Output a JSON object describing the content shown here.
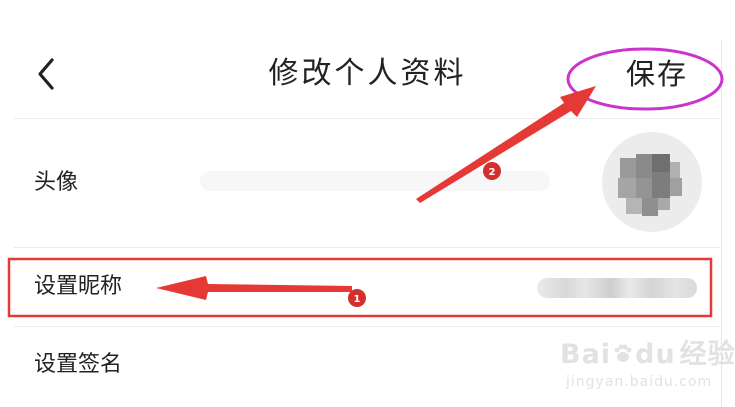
{
  "header": {
    "back_icon": "chevron-left-icon",
    "title": "修改个人资料",
    "save_label": "保存"
  },
  "rows": [
    {
      "label": "头像",
      "value_type": "avatar-image"
    },
    {
      "label": "设置昵称",
      "value_type": "blurred-text"
    },
    {
      "label": "设置签名",
      "value_type": "empty"
    }
  ],
  "annotations": [
    {
      "label": "1",
      "target": "设置昵称"
    },
    {
      "label": "2",
      "target": "保存"
    }
  ],
  "watermark": {
    "logo_text": "Bai",
    "logo_text_end": "du",
    "product_text": "经验",
    "url": "jingyan.baidu.com"
  },
  "colors": {
    "highlight_box": "#e53935",
    "save_circle": "#cc33cc",
    "arrow": "#e53935",
    "badge": "#d32f2f",
    "text": "#222222",
    "divider": "#ececec"
  }
}
